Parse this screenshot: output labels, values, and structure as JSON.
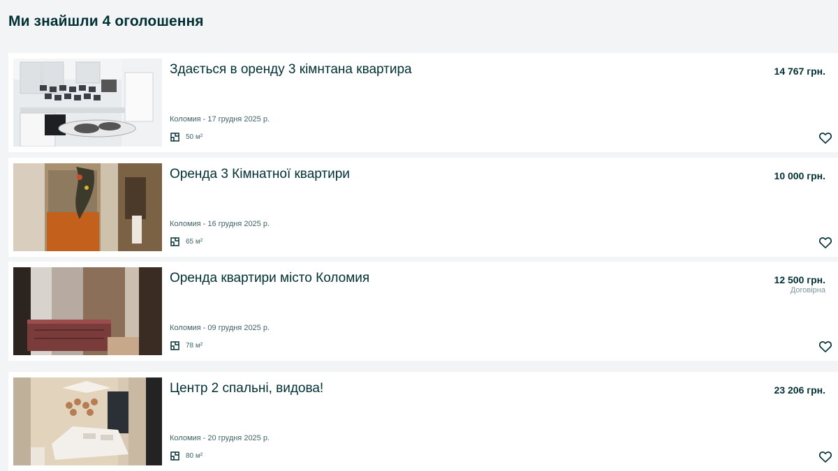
{
  "header": {
    "title": "Ми знайшли 4 оголошення"
  },
  "listings": [
    {
      "title": "Здається в оренду 3 кімнтана квартира",
      "location_date": "Коломия - 17 грудня 2025 р.",
      "area": "50 м²",
      "price": "14 767 грн.",
      "negotiable": "",
      "photo_icon": "kitchen-photo"
    },
    {
      "title": "Оренда 3 Кімнатної квартири",
      "location_date": "Коломия - 16 грудня 2025 р.",
      "area": "65 м²",
      "price": "10 000 грн.",
      "negotiable": "",
      "photo_icon": "hallway-photo"
    },
    {
      "title": "Оренда квартири місто Коломия",
      "location_date": "Коломия - 09 грудня 2025 р.",
      "area": "78 м²",
      "price": "12 500 грн.",
      "negotiable": "Договірна",
      "photo_icon": "bedroom-photo"
    },
    {
      "title": "Центр 2 спальні, видова!",
      "location_date": "Коломия - 20 грудня 2025 р.",
      "area": "80 м²",
      "price": "23 206 грн.",
      "negotiable": "",
      "photo_icon": "bedroom-photo"
    }
  ],
  "icons": {
    "area": "floor-plan-icon",
    "favorite": "heart-outline-icon"
  },
  "colors": {
    "text": "#002f34",
    "muted": "#406367",
    "background": "#f2f4f5",
    "card": "#ffffff"
  }
}
